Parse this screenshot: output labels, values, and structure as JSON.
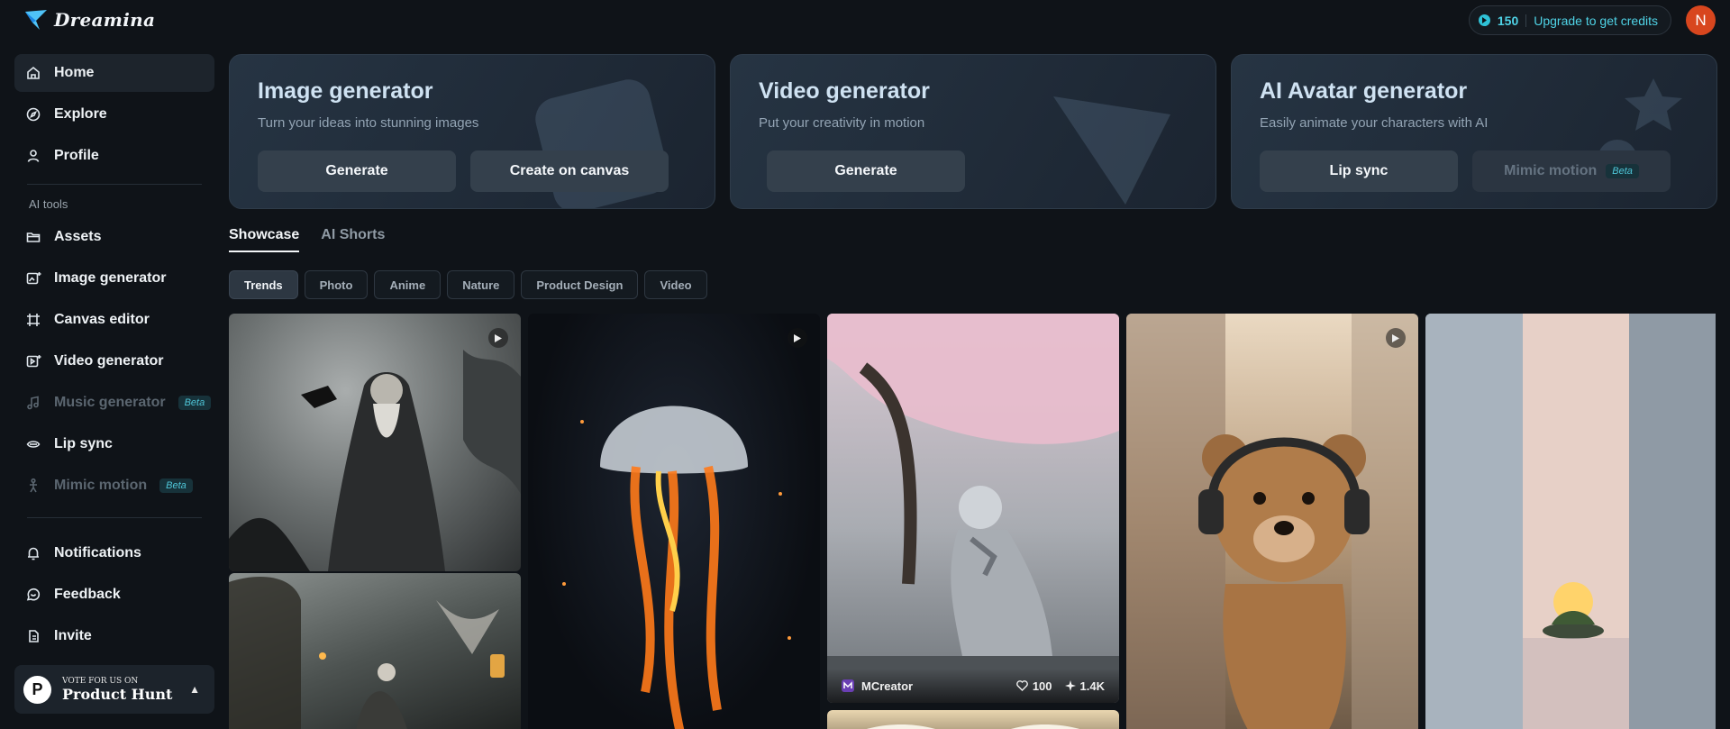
{
  "app": {
    "name": "Dreamina"
  },
  "header": {
    "credits": "150",
    "upgrade_label": "Upgrade to get credits",
    "avatar_initial": "N"
  },
  "sidebar": {
    "items": [
      {
        "label": "Home"
      },
      {
        "label": "Explore"
      },
      {
        "label": "Profile"
      }
    ],
    "section_label": "AI tools",
    "tools": [
      {
        "label": "Assets"
      },
      {
        "label": "Image generator"
      },
      {
        "label": "Canvas editor"
      },
      {
        "label": "Video generator"
      },
      {
        "label": "Music generator",
        "badge": "Beta"
      },
      {
        "label": "Lip sync"
      },
      {
        "label": "Mimic motion",
        "badge": "Beta"
      }
    ],
    "bottom": [
      {
        "label": "Notifications"
      },
      {
        "label": "Feedback"
      },
      {
        "label": "Invite"
      }
    ],
    "product_hunt": {
      "small": "VOTE FOR US ON",
      "big": "Product Hunt",
      "logo_letter": "P"
    }
  },
  "cards": [
    {
      "title": "Image generator",
      "subtitle": "Turn your ideas into stunning images",
      "buttons": [
        "Generate",
        "Create on canvas"
      ]
    },
    {
      "title": "Video generator",
      "subtitle": "Put your creativity in motion",
      "buttons": [
        "Generate"
      ]
    },
    {
      "title": "AI Avatar generator",
      "subtitle": "Easily animate your characters with AI",
      "buttons": [
        "Lip sync",
        "Mimic motion"
      ],
      "badge": "Beta"
    }
  ],
  "tabs": [
    "Showcase",
    "AI Shorts"
  ],
  "chips": [
    "Trends",
    "Photo",
    "Anime",
    "Nature",
    "Product Design",
    "Video"
  ],
  "gallery": {
    "featured": {
      "creator": "MCreator",
      "likes": "100",
      "uses": "1.4K"
    }
  },
  "colors": {
    "accent": "#4fd3e6",
    "background": "#0f1318",
    "avatar": "#d8461e"
  }
}
